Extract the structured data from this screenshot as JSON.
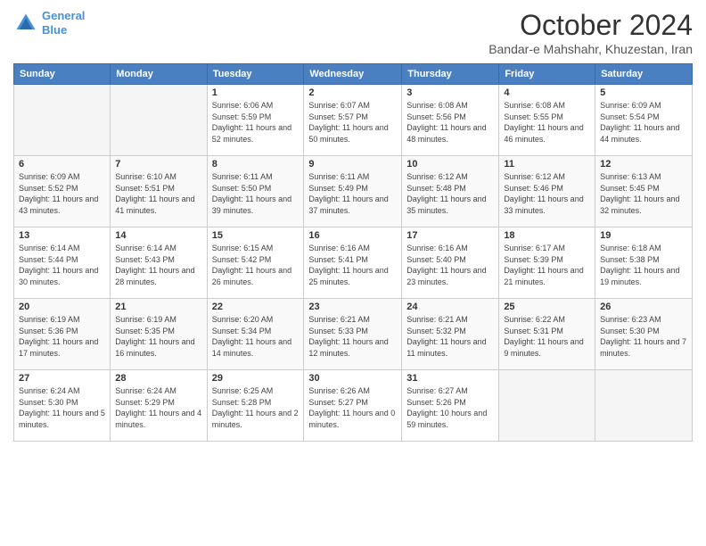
{
  "header": {
    "logo_line1": "General",
    "logo_line2": "Blue",
    "month": "October 2024",
    "location": "Bandar-e Mahshahr, Khuzestan, Iran"
  },
  "weekdays": [
    "Sunday",
    "Monday",
    "Tuesday",
    "Wednesday",
    "Thursday",
    "Friday",
    "Saturday"
  ],
  "weeks": [
    [
      {
        "day": "",
        "info": ""
      },
      {
        "day": "",
        "info": ""
      },
      {
        "day": "1",
        "info": "Sunrise: 6:06 AM\nSunset: 5:59 PM\nDaylight: 11 hours and 52 minutes."
      },
      {
        "day": "2",
        "info": "Sunrise: 6:07 AM\nSunset: 5:57 PM\nDaylight: 11 hours and 50 minutes."
      },
      {
        "day": "3",
        "info": "Sunrise: 6:08 AM\nSunset: 5:56 PM\nDaylight: 11 hours and 48 minutes."
      },
      {
        "day": "4",
        "info": "Sunrise: 6:08 AM\nSunset: 5:55 PM\nDaylight: 11 hours and 46 minutes."
      },
      {
        "day": "5",
        "info": "Sunrise: 6:09 AM\nSunset: 5:54 PM\nDaylight: 11 hours and 44 minutes."
      }
    ],
    [
      {
        "day": "6",
        "info": "Sunrise: 6:09 AM\nSunset: 5:52 PM\nDaylight: 11 hours and 43 minutes."
      },
      {
        "day": "7",
        "info": "Sunrise: 6:10 AM\nSunset: 5:51 PM\nDaylight: 11 hours and 41 minutes."
      },
      {
        "day": "8",
        "info": "Sunrise: 6:11 AM\nSunset: 5:50 PM\nDaylight: 11 hours and 39 minutes."
      },
      {
        "day": "9",
        "info": "Sunrise: 6:11 AM\nSunset: 5:49 PM\nDaylight: 11 hours and 37 minutes."
      },
      {
        "day": "10",
        "info": "Sunrise: 6:12 AM\nSunset: 5:48 PM\nDaylight: 11 hours and 35 minutes."
      },
      {
        "day": "11",
        "info": "Sunrise: 6:12 AM\nSunset: 5:46 PM\nDaylight: 11 hours and 33 minutes."
      },
      {
        "day": "12",
        "info": "Sunrise: 6:13 AM\nSunset: 5:45 PM\nDaylight: 11 hours and 32 minutes."
      }
    ],
    [
      {
        "day": "13",
        "info": "Sunrise: 6:14 AM\nSunset: 5:44 PM\nDaylight: 11 hours and 30 minutes."
      },
      {
        "day": "14",
        "info": "Sunrise: 6:14 AM\nSunset: 5:43 PM\nDaylight: 11 hours and 28 minutes."
      },
      {
        "day": "15",
        "info": "Sunrise: 6:15 AM\nSunset: 5:42 PM\nDaylight: 11 hours and 26 minutes."
      },
      {
        "day": "16",
        "info": "Sunrise: 6:16 AM\nSunset: 5:41 PM\nDaylight: 11 hours and 25 minutes."
      },
      {
        "day": "17",
        "info": "Sunrise: 6:16 AM\nSunset: 5:40 PM\nDaylight: 11 hours and 23 minutes."
      },
      {
        "day": "18",
        "info": "Sunrise: 6:17 AM\nSunset: 5:39 PM\nDaylight: 11 hours and 21 minutes."
      },
      {
        "day": "19",
        "info": "Sunrise: 6:18 AM\nSunset: 5:38 PM\nDaylight: 11 hours and 19 minutes."
      }
    ],
    [
      {
        "day": "20",
        "info": "Sunrise: 6:19 AM\nSunset: 5:36 PM\nDaylight: 11 hours and 17 minutes."
      },
      {
        "day": "21",
        "info": "Sunrise: 6:19 AM\nSunset: 5:35 PM\nDaylight: 11 hours and 16 minutes."
      },
      {
        "day": "22",
        "info": "Sunrise: 6:20 AM\nSunset: 5:34 PM\nDaylight: 11 hours and 14 minutes."
      },
      {
        "day": "23",
        "info": "Sunrise: 6:21 AM\nSunset: 5:33 PM\nDaylight: 11 hours and 12 minutes."
      },
      {
        "day": "24",
        "info": "Sunrise: 6:21 AM\nSunset: 5:32 PM\nDaylight: 11 hours and 11 minutes."
      },
      {
        "day": "25",
        "info": "Sunrise: 6:22 AM\nSunset: 5:31 PM\nDaylight: 11 hours and 9 minutes."
      },
      {
        "day": "26",
        "info": "Sunrise: 6:23 AM\nSunset: 5:30 PM\nDaylight: 11 hours and 7 minutes."
      }
    ],
    [
      {
        "day": "27",
        "info": "Sunrise: 6:24 AM\nSunset: 5:30 PM\nDaylight: 11 hours and 5 minutes."
      },
      {
        "day": "28",
        "info": "Sunrise: 6:24 AM\nSunset: 5:29 PM\nDaylight: 11 hours and 4 minutes."
      },
      {
        "day": "29",
        "info": "Sunrise: 6:25 AM\nSunset: 5:28 PM\nDaylight: 11 hours and 2 minutes."
      },
      {
        "day": "30",
        "info": "Sunrise: 6:26 AM\nSunset: 5:27 PM\nDaylight: 11 hours and 0 minutes."
      },
      {
        "day": "31",
        "info": "Sunrise: 6:27 AM\nSunset: 5:26 PM\nDaylight: 10 hours and 59 minutes."
      },
      {
        "day": "",
        "info": ""
      },
      {
        "day": "",
        "info": ""
      }
    ]
  ]
}
